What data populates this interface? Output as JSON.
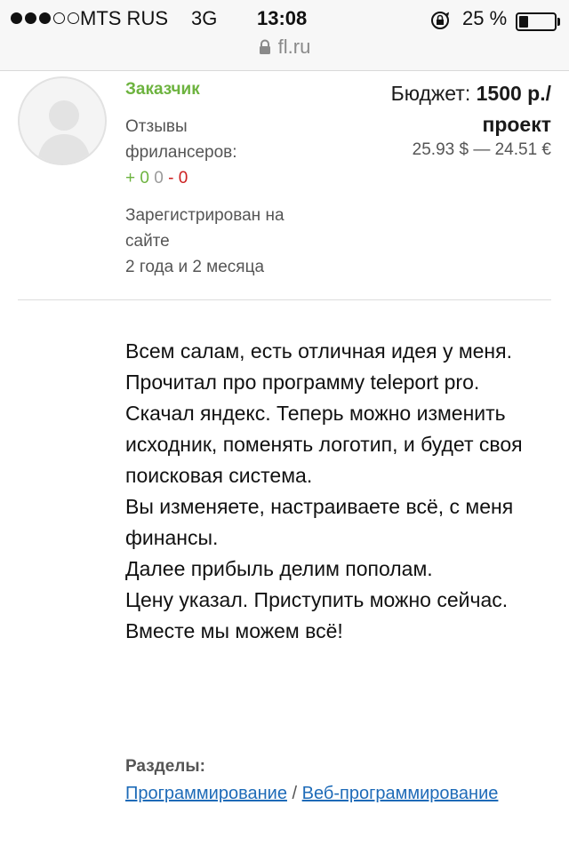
{
  "status_bar": {
    "carrier": "MTS RUS",
    "network": "3G",
    "time": "13:08",
    "battery_percent": "25 %",
    "battery_level": 0.25
  },
  "address_bar": {
    "url": "fl.ru"
  },
  "customer": {
    "role_label": "Заказчик",
    "reviews_label": "Отзывы фрилансеров:",
    "reviews_positive": "+ 0",
    "reviews_neutral": "0",
    "reviews_negative": "- 0",
    "registered_label": "Зарегистрирован на сайте",
    "registered_duration": "2 года и 2 месяца"
  },
  "budget": {
    "label": "Бюджет:",
    "amount": "1500 р./",
    "per": "проект",
    "conversions": "25.93 $ — 24.51 €"
  },
  "description": {
    "paragraphs": [
      "Всем салам, есть отличная идея у меня.",
      "Прочитал про программу teleport pro.",
      "Скачал яндекс. Теперь можно изменить исходник, поменять логотип, и будет своя поисковая система.",
      "Вы изменяете, настраиваете всё, с меня финансы.",
      "Далее прибыль делим пополам.",
      "Цену указал. Приступить можно сейчас.",
      "Вместе мы можем всё!"
    ]
  },
  "sections": {
    "title": "Разделы:",
    "links": [
      "Программирование",
      "Веб-программирование"
    ],
    "separator": "/"
  },
  "colors": {
    "accent_green": "#6db33f",
    "negative_red": "#cc1f1f",
    "link_blue": "#1e6bb8"
  }
}
